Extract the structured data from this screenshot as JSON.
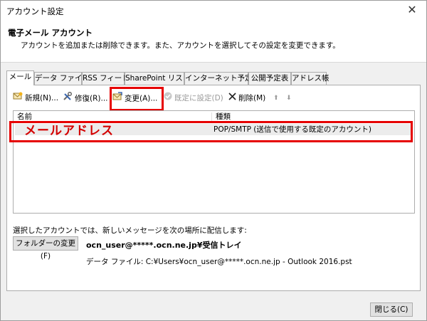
{
  "window": {
    "title": "アカウント設定",
    "close_glyph": "✕"
  },
  "header": {
    "title": "電子メール アカウント",
    "description": "アカウントを追加または削除できます。また、アカウントを選択してその設定を変更できます。"
  },
  "tabs": [
    {
      "label": "メール"
    },
    {
      "label": "データ ファイル"
    },
    {
      "label": "RSS フィード"
    },
    {
      "label": "SharePoint リスト"
    },
    {
      "label": "インターネット予定表"
    },
    {
      "label": "公開予定表"
    },
    {
      "label": "アドレス帳"
    }
  ],
  "toolbar": {
    "new_label": "新規(N)...",
    "repair_label": "修復(R)...",
    "change_label": "変更(A)...",
    "default_label": "既定に設定(D)",
    "delete_label": "削除(M)",
    "up_glyph": "⬆",
    "down_glyph": "⬇"
  },
  "accounts_list": {
    "columns": [
      "名前",
      "種類"
    ],
    "rows": [
      {
        "name": "メールアドレス",
        "type": "POP/SMTP (送信で使用する既定のアカウント)"
      }
    ]
  },
  "delivery": {
    "label": "選択したアカウントでは、新しいメッセージを次の場所に配信します:",
    "folder_button": "フォルダーの変更(F)",
    "path": "ocn_user@*****.ocn.ne.jp¥受信トレイ",
    "data_file": "データ ファイル: C:¥Users¥ocn_user@*****.ocn.ne.jp - Outlook 2016.pst"
  },
  "footer": {
    "close_label": "閉じる(C)"
  },
  "colors": {
    "highlight": "#e60000",
    "name_text": "#d40000"
  }
}
